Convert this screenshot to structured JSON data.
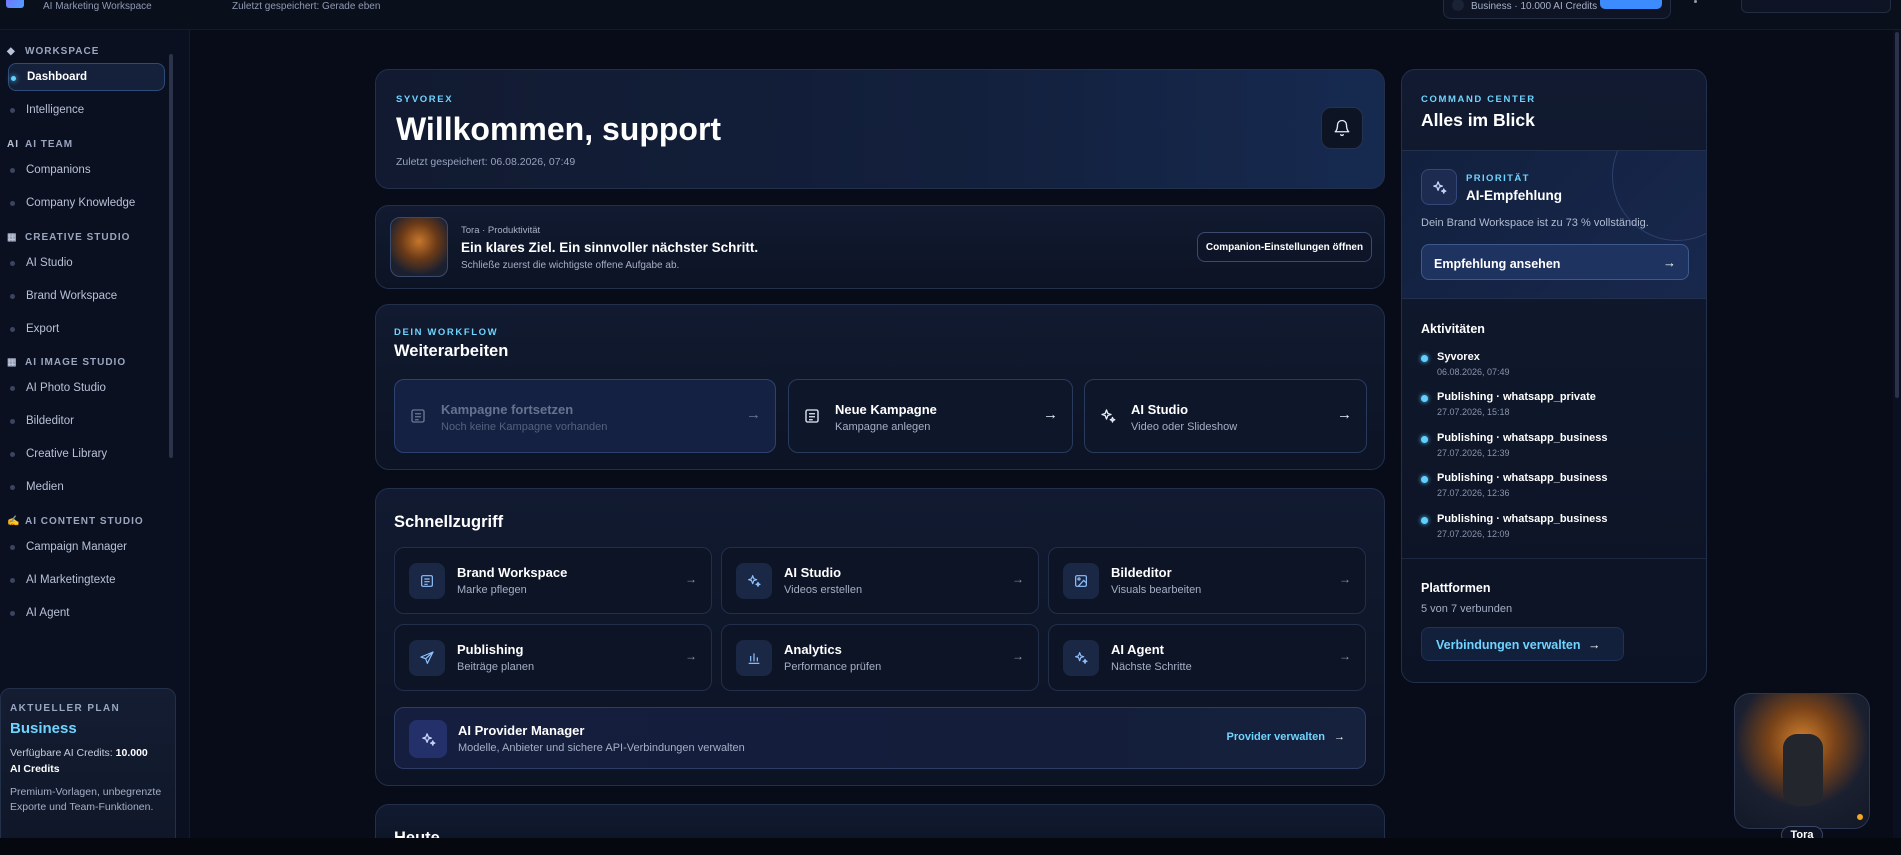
{
  "topbar": {
    "workspace_label": "AI Marketing Workspace",
    "saved_status": "Zuletzt gespeichert: Gerade eben",
    "plan_info": "Business · 10.000 AI Credits"
  },
  "sidebar": {
    "sections": [
      {
        "glyph": "◆",
        "label": "WORKSPACE"
      },
      {
        "glyph": "AI",
        "label": "AI TEAM"
      },
      {
        "glyph": "▦",
        "label": "CREATIVE STUDIO"
      },
      {
        "glyph": "▦",
        "label": "AI IMAGE STUDIO"
      },
      {
        "glyph": "✍",
        "label": "AI CONTENT STUDIO"
      }
    ],
    "items": [
      {
        "label": "Dashboard"
      },
      {
        "label": "Intelligence"
      },
      {
        "label": "Companions"
      },
      {
        "label": "Company Knowledge"
      },
      {
        "label": "AI Studio"
      },
      {
        "label": "Brand Workspace"
      },
      {
        "label": "Export"
      },
      {
        "label": "AI Photo Studio"
      },
      {
        "label": "Bildeditor"
      },
      {
        "label": "Creative Library"
      },
      {
        "label": "Medien"
      },
      {
        "label": "Campaign Manager"
      },
      {
        "label": "AI Marketingtexte"
      },
      {
        "label": "AI Agent"
      }
    ],
    "plan": {
      "label": "AKTUELLER PLAN",
      "name": "Business",
      "credits_prefix": "Verfügbare AI Credits: ",
      "credits_value": "10.000",
      "credits_unit": "AI Credits",
      "perks": "Premium-Vorlagen, unbegrenzte Exporte und Team-Funktionen."
    }
  },
  "hero": {
    "eyebrow": "SYVOREX",
    "title": "Willkommen, support",
    "saved": "Zuletzt gespeichert: 06.08.2026, 07:49"
  },
  "companion": {
    "meta": "Tora · Produktivität",
    "title": "Ein klares Ziel. Ein sinnvoller nächster Schritt.",
    "subtitle": "Schließe zuerst die wichtigste offene Aufgabe ab.",
    "button": "Companion-Einstellungen öffnen"
  },
  "workflow": {
    "eyebrow": "DEIN WORKFLOW",
    "title": "Weiterarbeiten",
    "tiles": [
      {
        "title": "Kampagne fortsetzen",
        "subtitle": "Noch keine Kampagne vorhanden",
        "icon": "document-icon"
      },
      {
        "title": "Neue Kampagne",
        "subtitle": "Kampagne anlegen",
        "icon": "document-icon"
      },
      {
        "title": "AI Studio",
        "subtitle": "Video oder Slideshow",
        "icon": "sparkle-icon"
      }
    ]
  },
  "quick": {
    "title": "Schnellzugriff",
    "tiles": [
      {
        "title": "Brand Workspace",
        "subtitle": "Marke pflegen",
        "icon": "document-icon"
      },
      {
        "title": "AI Studio",
        "subtitle": "Videos erstellen",
        "icon": "sparkle-icon"
      },
      {
        "title": "Bildeditor",
        "subtitle": "Visuals bearbeiten",
        "icon": "image-icon"
      },
      {
        "title": "Publishing",
        "subtitle": "Beiträge planen",
        "icon": "send-icon"
      },
      {
        "title": "Analytics",
        "subtitle": "Performance prüfen",
        "icon": "bar-chart-icon"
      },
      {
        "title": "AI Agent",
        "subtitle": "Nächste Schritte",
        "icon": "sparkle-icon"
      }
    ],
    "provider": {
      "title": "AI Provider Manager",
      "subtitle": "Modelle, Anbieter und sichere API-Verbindungen verwalten",
      "action": "Provider verwalten"
    }
  },
  "today": {
    "title": "Heute"
  },
  "right_panel": {
    "eyebrow": "COMMAND CENTER",
    "title": "Alles im Blick",
    "priority": {
      "label": "PRIORITÄT",
      "title": "AI-Empfehlung",
      "desc": "Dein Brand Workspace ist zu 73 % vollständig.",
      "button": "Empfehlung ansehen"
    },
    "activities_title": "Aktivitäten",
    "activities": [
      {
        "name": "Syvorex",
        "time": "06.08.2026, 07:49"
      },
      {
        "name": "Publishing · whatsapp_private",
        "time": "27.07.2026, 15:18"
      },
      {
        "name": "Publishing · whatsapp_business",
        "time": "27.07.2026, 12:39"
      },
      {
        "name": "Publishing · whatsapp_business",
        "time": "27.07.2026, 12:36"
      },
      {
        "name": "Publishing · whatsapp_business",
        "time": "27.07.2026, 12:09"
      }
    ],
    "platforms_title": "Plattformen",
    "platforms_count": "5 von 7 verbunden",
    "connections_button": "Verbindungen verwalten"
  },
  "mascot": {
    "name": "Tora"
  },
  "colors": {
    "accent": "#6fd4ff",
    "background": "#080c18",
    "card": "#111a30"
  }
}
